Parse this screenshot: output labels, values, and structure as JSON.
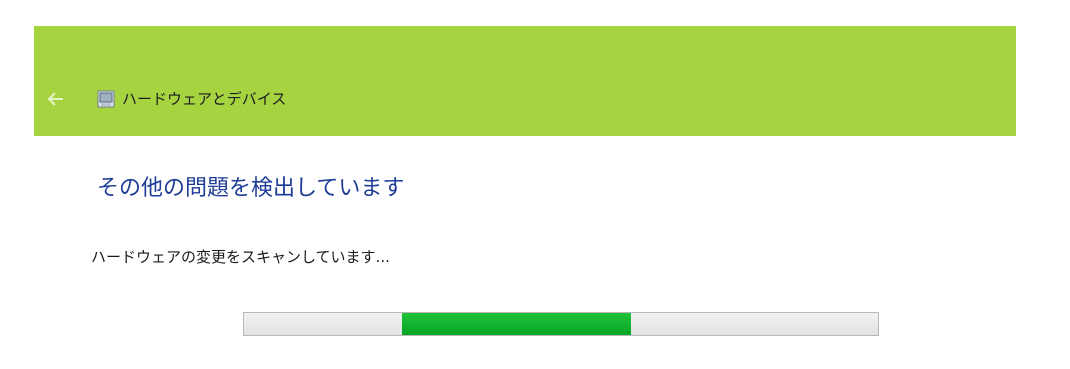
{
  "header": {
    "title": "ハードウェアとデバイス",
    "back_icon": "back-arrow-icon",
    "app_icon": "troubleshooter-icon",
    "background_color": "#a6d441"
  },
  "main": {
    "heading": "その他の問題を検出しています",
    "heading_color": "#1e3d96",
    "status": "ハードウェアの変更をスキャンしています...",
    "progress": {
      "mode": "indeterminate",
      "fill_color": "#0fb82e"
    }
  }
}
